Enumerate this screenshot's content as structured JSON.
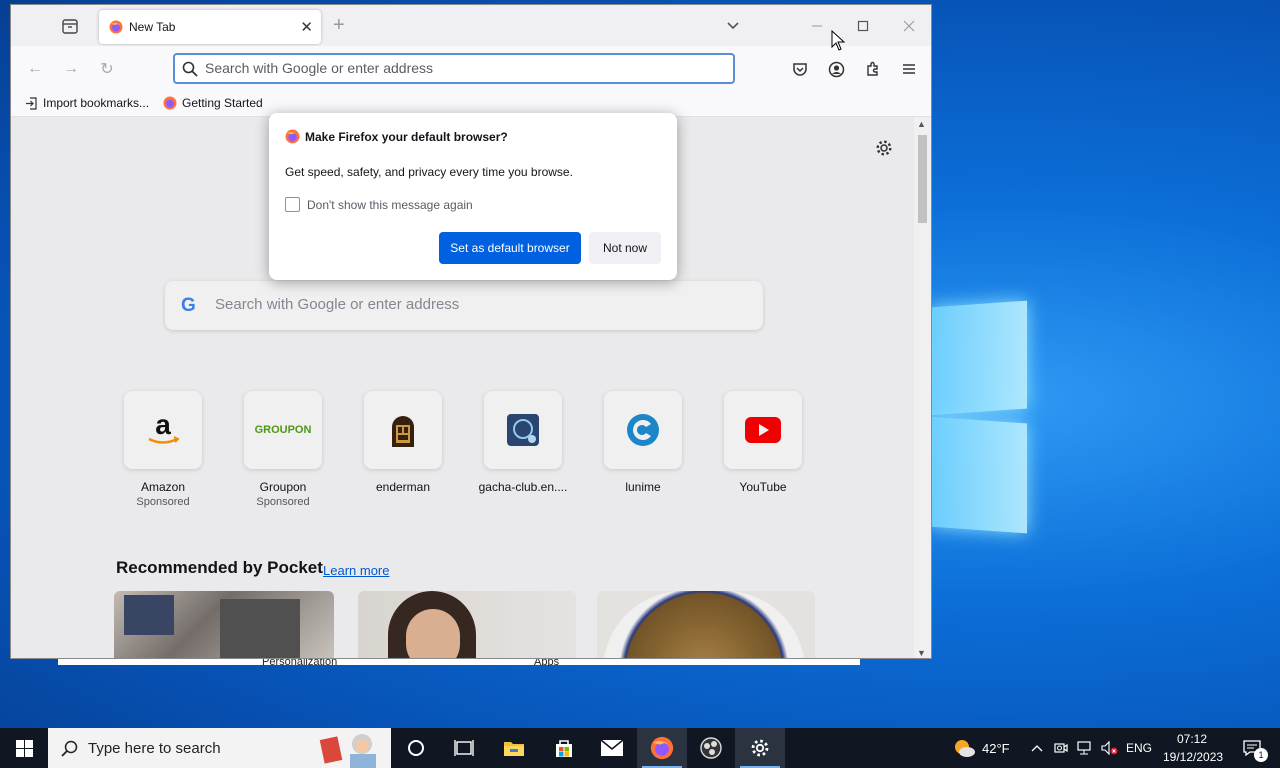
{
  "browser": {
    "tab_title": "New Tab",
    "url_placeholder": "Search with Google or enter address",
    "bookmarks": [
      {
        "label": "Import bookmarks..."
      },
      {
        "label": "Getting Started"
      }
    ],
    "search_placeholder": "Search with Google or enter address",
    "top_sites": [
      {
        "name": "Amazon",
        "sponsored": "Sponsored",
        "icon": "amazon-logo"
      },
      {
        "name": "Groupon",
        "sponsored": "Sponsored",
        "icon": "groupon-logo",
        "logo_text": "GROUPON"
      },
      {
        "name": "enderman",
        "sponsored": "",
        "icon": "enderman-icon"
      },
      {
        "name": "gacha-club.en....",
        "sponsored": "",
        "icon": "gacha-club-icon"
      },
      {
        "name": "lunime",
        "sponsored": "",
        "icon": "lunime-icon"
      },
      {
        "name": "YouTube",
        "sponsored": "",
        "icon": "youtube-icon"
      }
    ],
    "pocket_heading": "Recommended by Pocket",
    "pocket_learn_more": "Learn more"
  },
  "dialog": {
    "title": "Make Firefox your default browser?",
    "body": "Get speed, safety, and privacy every time you browse.",
    "checkbox_label": "Don't show this message again",
    "primary_button": "Set as default browser",
    "secondary_button": "Not now"
  },
  "background_window": {
    "item1": "Personalization",
    "item2": "Apps"
  },
  "taskbar": {
    "search_placeholder": "Type here to search",
    "weather_temp": "42°F",
    "language": "ENG",
    "time": "07:12",
    "date": "19/12/2023",
    "notification_count": "1"
  },
  "colors": {
    "accent": "#0061e0",
    "taskbar": "#101722",
    "desktop": "#0c6fd8"
  }
}
